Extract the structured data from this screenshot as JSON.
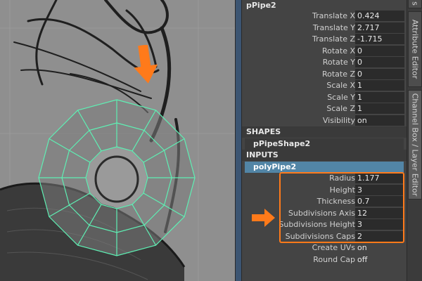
{
  "node": {
    "transform_name": "pPipe2"
  },
  "transform_attrs": [
    {
      "label": "Translate X",
      "value": "0.424"
    },
    {
      "label": "Translate Y",
      "value": "2.717"
    },
    {
      "label": "Translate Z",
      "value": "-1.715"
    },
    {
      "label": "Rotate X",
      "value": "0"
    },
    {
      "label": "Rotate Y",
      "value": "0"
    },
    {
      "label": "Rotate Z",
      "value": "0"
    },
    {
      "label": "Scale X",
      "value": "1"
    },
    {
      "label": "Scale Y",
      "value": "1"
    },
    {
      "label": "Scale Z",
      "value": "1"
    },
    {
      "label": "Visibility",
      "value": "on"
    }
  ],
  "shapes": {
    "header": "SHAPES",
    "item": "pPipeShape2"
  },
  "inputs": {
    "header": "INPUTS",
    "item": "polyPipe2",
    "attrs": [
      {
        "label": "Radius",
        "value": "1.177"
      },
      {
        "label": "Height",
        "value": "3"
      },
      {
        "label": "Thickness",
        "value": "0.7"
      },
      {
        "label": "Subdivisions Axis",
        "value": "12"
      },
      {
        "label": "Subdivisions Height",
        "value": "3"
      },
      {
        "label": "Subdivisions Caps",
        "value": "2"
      },
      {
        "label": "Create UVs",
        "value": "on"
      },
      {
        "label": "Round Cap",
        "value": "off"
      }
    ]
  },
  "side_tabs": {
    "top_partial": "s",
    "attribute_editor": "Attribute Editor",
    "channel_box": "Channel Box / Layer Editor"
  },
  "colors": {
    "wireframe": "#5ef0b4",
    "highlight": "#ff7a1a",
    "selection": "#5285a6"
  }
}
